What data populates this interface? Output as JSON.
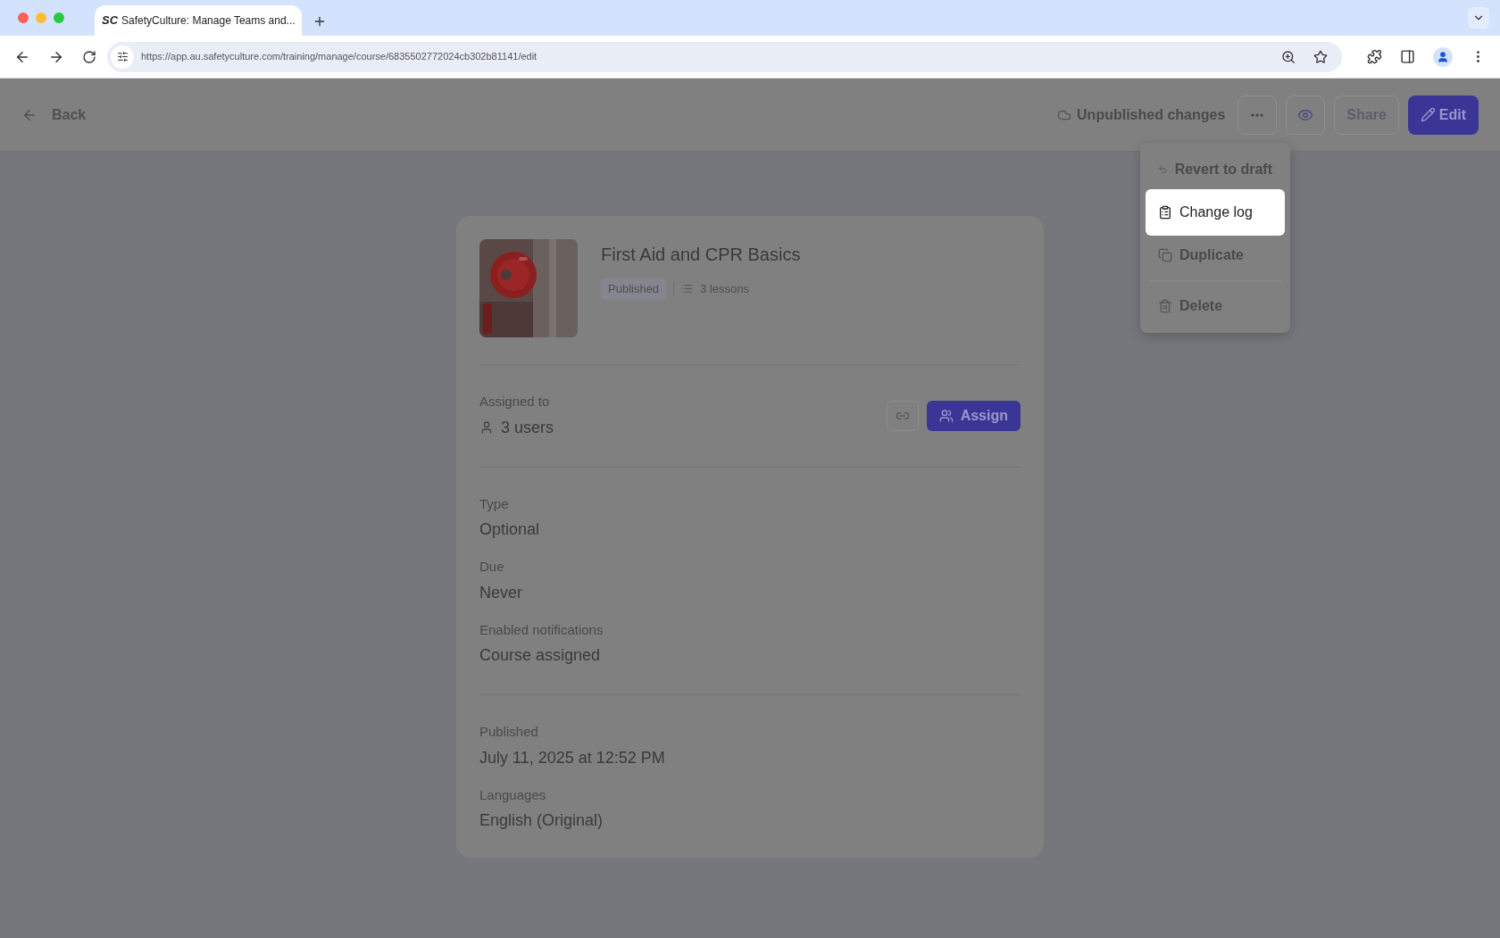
{
  "browser": {
    "tab_logo": "SC",
    "tab_title": "SafetyCulture: Manage Teams and...",
    "url": "https://app.au.safetyculture.com/training/manage/course/6835502772024cb302b81141/edit"
  },
  "header": {
    "back": "Back",
    "status": "Unpublished changes",
    "share": "Share",
    "edit": "Edit"
  },
  "menu": [
    {
      "label": "Revert to draft",
      "kind": "revert",
      "selected": false,
      "divider_before": false
    },
    {
      "label": "Change log",
      "kind": "log",
      "selected": true,
      "divider_before": false
    },
    {
      "label": "Duplicate",
      "kind": "duplicate",
      "selected": false,
      "divider_before": false
    },
    {
      "label": "Delete",
      "kind": "delete",
      "selected": false,
      "divider_before": true
    }
  ],
  "course": {
    "title": "First Aid and CPR Basics",
    "status": "Published",
    "lessons": "3 lessons",
    "assigned_label": "Assigned to",
    "assigned_value": "3 users",
    "assign_button": "Assign",
    "sections": [
      [
        {
          "label": "Type",
          "value": "Optional"
        },
        {
          "label": "Due",
          "value": "Never"
        },
        {
          "label": "Enabled notifications",
          "value": "Course assigned"
        }
      ],
      [
        {
          "label": "Published",
          "value": "July 11, 2025 at 12:52 PM"
        },
        {
          "label": "Languages",
          "value": "English (Original)"
        }
      ]
    ]
  }
}
